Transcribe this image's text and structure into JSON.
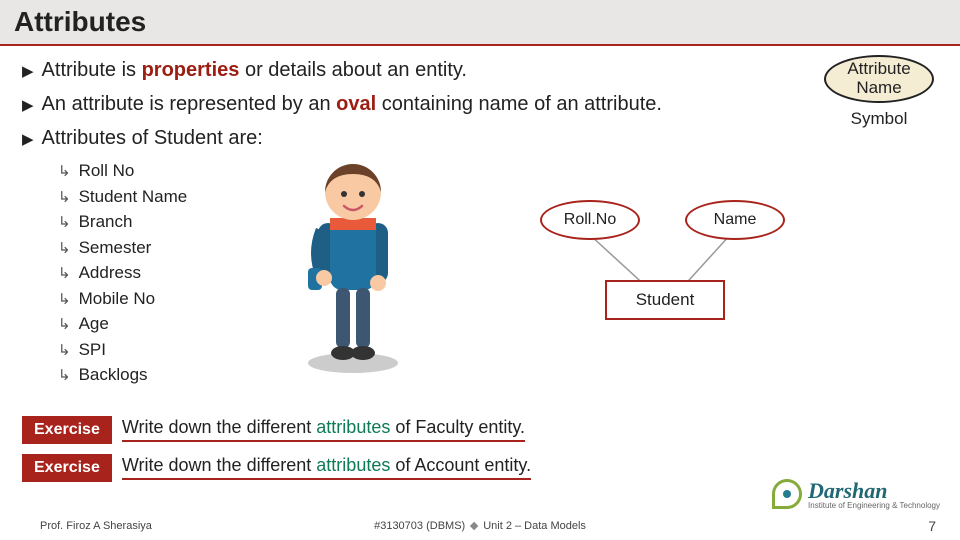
{
  "header": {
    "title": "Attributes"
  },
  "bullets": {
    "b1_pre": "Attribute is ",
    "b1_hl": "properties",
    "b1_post": " or details about an entity.",
    "b2_pre": "An attribute is represented by an ",
    "b2_hl": "oval",
    "b2_post": " containing name of an attribute.",
    "b3": "Attributes of Student are:"
  },
  "sublist": {
    "i0": "Roll No",
    "i1": "Student Name",
    "i2": "Branch",
    "i3": "Semester",
    "i4": "Address",
    "i5": "Mobile No",
    "i6": "Age",
    "i7": "SPI",
    "i8": "Backlogs"
  },
  "symbol": {
    "text": "Attribute Name",
    "label": "Symbol"
  },
  "er": {
    "rollno": "Roll.No",
    "name": "Name",
    "entity": "Student"
  },
  "exercise": {
    "label": "Exercise",
    "e1_pre": "Write down the different ",
    "e1_attr": "attributes",
    "e1_post": " of Faculty entity.",
    "e2_pre": "Write down the different ",
    "e2_attr": "attributes",
    "e2_post": " of Account entity."
  },
  "footer": {
    "prof": "Prof. Firoz A Sherasiya",
    "code": "#3130703 (DBMS)",
    "unit": "Unit 2 – Data Models",
    "page": "7"
  },
  "logo": {
    "name": "Darshan",
    "sub": "Institute of Engineering & Technology"
  }
}
